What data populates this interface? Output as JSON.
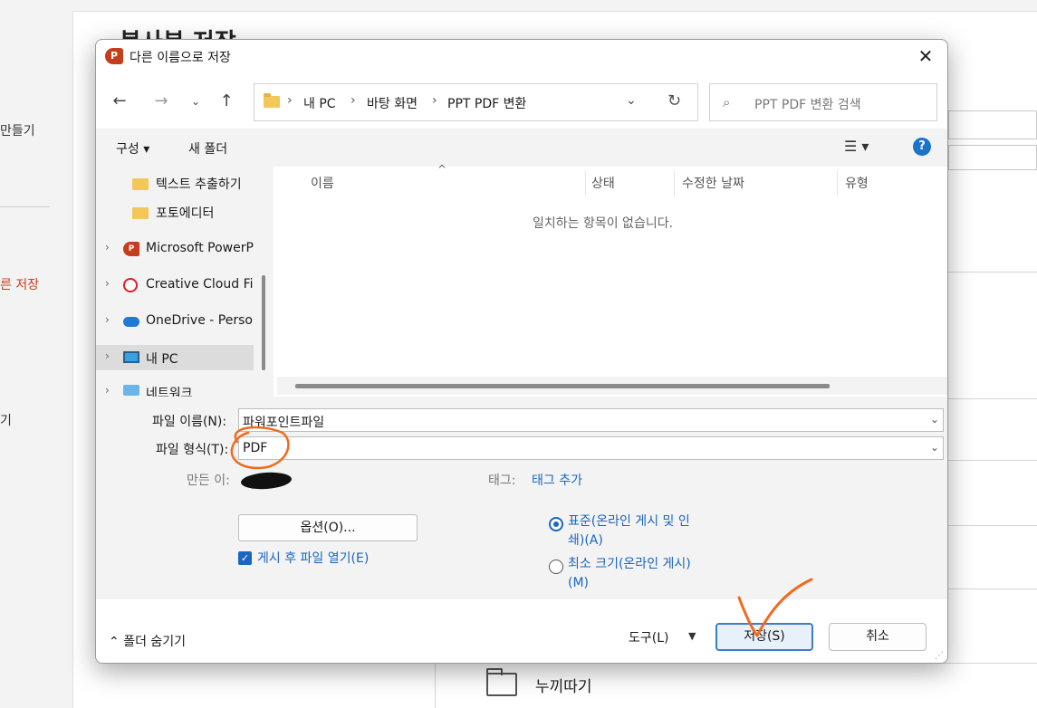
{
  "background": {
    "heading": "복사본 저장",
    "left_items": [
      "만들기",
      "른 저장",
      "기"
    ],
    "folder_row_label": "누끼따기"
  },
  "dialog": {
    "title": "다른 이름으로 저장",
    "nav": {
      "breadcrumbs": [
        "내 PC",
        "바탕 화면",
        "PPT PDF 변환"
      ],
      "search_placeholder": "PPT PDF 변환 검색"
    },
    "commands": {
      "organize": "구성 ▾",
      "new_folder": "새 폴더"
    },
    "tree": [
      {
        "label": "텍스트 추출하기",
        "icon": "folder-icon"
      },
      {
        "label": "포토에디터",
        "icon": "folder-icon"
      },
      {
        "label": "Microsoft PowerPoint",
        "icon": "powerpoint-icon"
      },
      {
        "label": "Creative Cloud Files",
        "icon": "creative-cloud-icon"
      },
      {
        "label": "OneDrive - Personal",
        "icon": "onedrive-icon"
      },
      {
        "label": "내 PC",
        "icon": "pc-icon"
      },
      {
        "label": "네트워크",
        "icon": "network-icon"
      }
    ],
    "columns": [
      "이름",
      "상태",
      "수정한 날짜",
      "유형"
    ],
    "empty_message": "일치하는 항목이 없습니다.",
    "form": {
      "filename_label": "파일 이름(N):",
      "filename_value": "파워포인트파일",
      "filetype_label": "파일 형식(T):",
      "filetype_value": "PDF",
      "author_label": "만든 이:",
      "tags_label": "태그:",
      "tags_link": "태그 추가",
      "options_button": "옵션(O)...",
      "open_after_publish": "게시 후 파일 열기(E)",
      "open_after_publish_checked": true,
      "optimize_standard": "표준(온라인 게시 및 인쇄)(A)",
      "optimize_minimum": "최소 크기(온라인 게시)(M)",
      "selected_optimize": "standard"
    },
    "footer": {
      "hide_folders": "폴더 숨기기",
      "tools": "도구(L)",
      "save": "저장(S)",
      "cancel": "취소"
    }
  },
  "colors": {
    "accent": "#1a66c0",
    "ppt_red": "#c43e1c",
    "annotation": "#f06a1e"
  }
}
